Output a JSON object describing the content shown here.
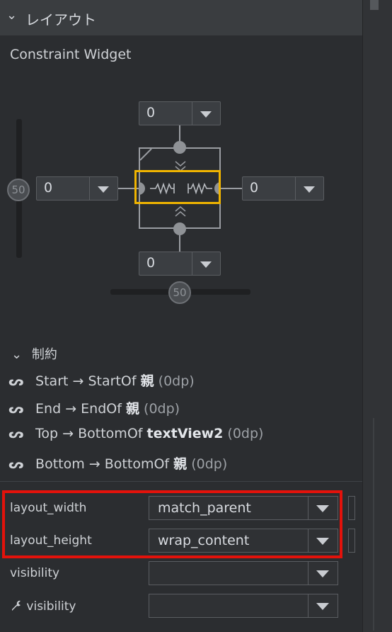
{
  "header": {
    "title": "レイアウト"
  },
  "widget": {
    "title": "Constraint Widget",
    "top_margin": "0",
    "left_margin": "0",
    "right_margin": "0",
    "bottom_margin": "0",
    "vertical_bias": "50",
    "horizontal_bias": "50"
  },
  "constraints": {
    "title": "制約",
    "rows": [
      {
        "side": "Start",
        "arrow": "→",
        "target_prefix": "StartOf",
        "target": "親",
        "margin": "(0dp)"
      },
      {
        "side": "End",
        "arrow": "→",
        "target_prefix": "EndOf",
        "target": "親",
        "margin": "(0dp)"
      },
      {
        "side": "Top",
        "arrow": "→",
        "target_prefix": "BottomOf",
        "target": "textView2",
        "margin": "(0dp)"
      },
      {
        "side": "Bottom",
        "arrow": "→",
        "target_prefix": "BottomOf",
        "target": "親",
        "margin": "(0dp)"
      }
    ]
  },
  "attributes": [
    {
      "label": "layout_width",
      "value": "match_parent"
    },
    {
      "label": "layout_height",
      "value": "wrap_content"
    },
    {
      "label": "visibility",
      "value": ""
    },
    {
      "label": "visibility",
      "value": ""
    }
  ],
  "colors": {
    "highlight_orange": "#f0b400",
    "highlight_red": "#e3120b",
    "background": "#2b2d30"
  },
  "icons": [
    "chevron-down-icon",
    "dropdown-arrow-icon",
    "constraint-icon",
    "wrench-icon"
  ]
}
